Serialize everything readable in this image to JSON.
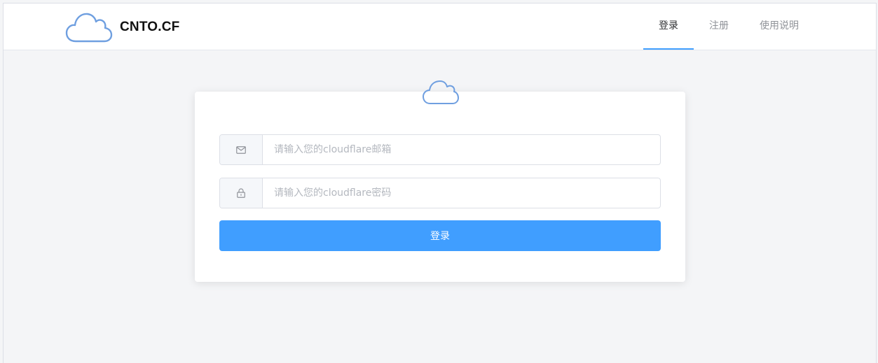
{
  "brand": {
    "name": "CNTO.CF",
    "icon": "cloud-icon"
  },
  "nav": {
    "items": [
      {
        "label": "登录",
        "active": true
      },
      {
        "label": "注册",
        "active": false
      },
      {
        "label": "使用说明",
        "active": false
      }
    ]
  },
  "login": {
    "logo_icon": "cloud-icon",
    "email": {
      "placeholder": "请输入您的cloudflare邮箱",
      "value": "",
      "icon": "mail-icon"
    },
    "password": {
      "placeholder": "请输入您的cloudflare密码",
      "value": "",
      "icon": "lock-icon"
    },
    "submit_label": "登录"
  },
  "colors": {
    "accent": "#409eff",
    "logo": "#6f9fe0",
    "background": "#f4f5f7"
  }
}
